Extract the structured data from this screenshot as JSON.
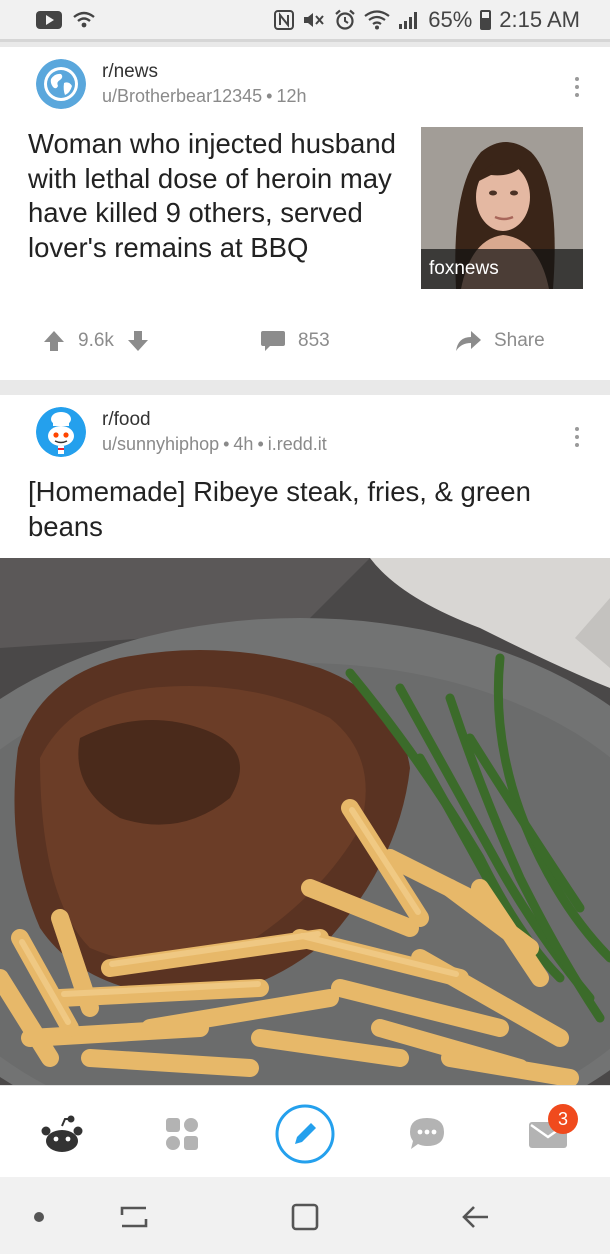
{
  "status_bar": {
    "battery_percent": "65%",
    "time": "2:15 AM",
    "icons": [
      "youtube-icon",
      "wifi-calling-icon",
      "nfc-icon",
      "mute-icon",
      "alarm-icon",
      "wifi-icon",
      "signal-icon",
      "battery-icon"
    ]
  },
  "posts": [
    {
      "subreddit": "r/news",
      "user": "u/Brotherbear12345",
      "age": "12h",
      "title": "Woman who injected husband with lethal dose of heroin may have killed 9 others, served lover's remains at BBQ",
      "thumbnail_source": "foxnews",
      "upvotes": "9.6k",
      "comments": "853",
      "share_label": "Share"
    },
    {
      "subreddit": "r/food",
      "user": "u/sunnyhiphop",
      "age": "4h",
      "domain": "i.redd.it",
      "title": "[Homemade] Ribeye steak, fries, & green beans"
    }
  ],
  "bottom_nav": {
    "items": [
      "home-icon",
      "communities-icon",
      "create-post-icon",
      "chat-icon",
      "inbox-icon"
    ],
    "inbox_badge": "3",
    "accent_color": "#24a0ed",
    "badge_color": "#f04a1d"
  },
  "system_nav": {
    "items": [
      "dot-icon",
      "recents-icon",
      "home-square-icon",
      "back-icon"
    ]
  }
}
